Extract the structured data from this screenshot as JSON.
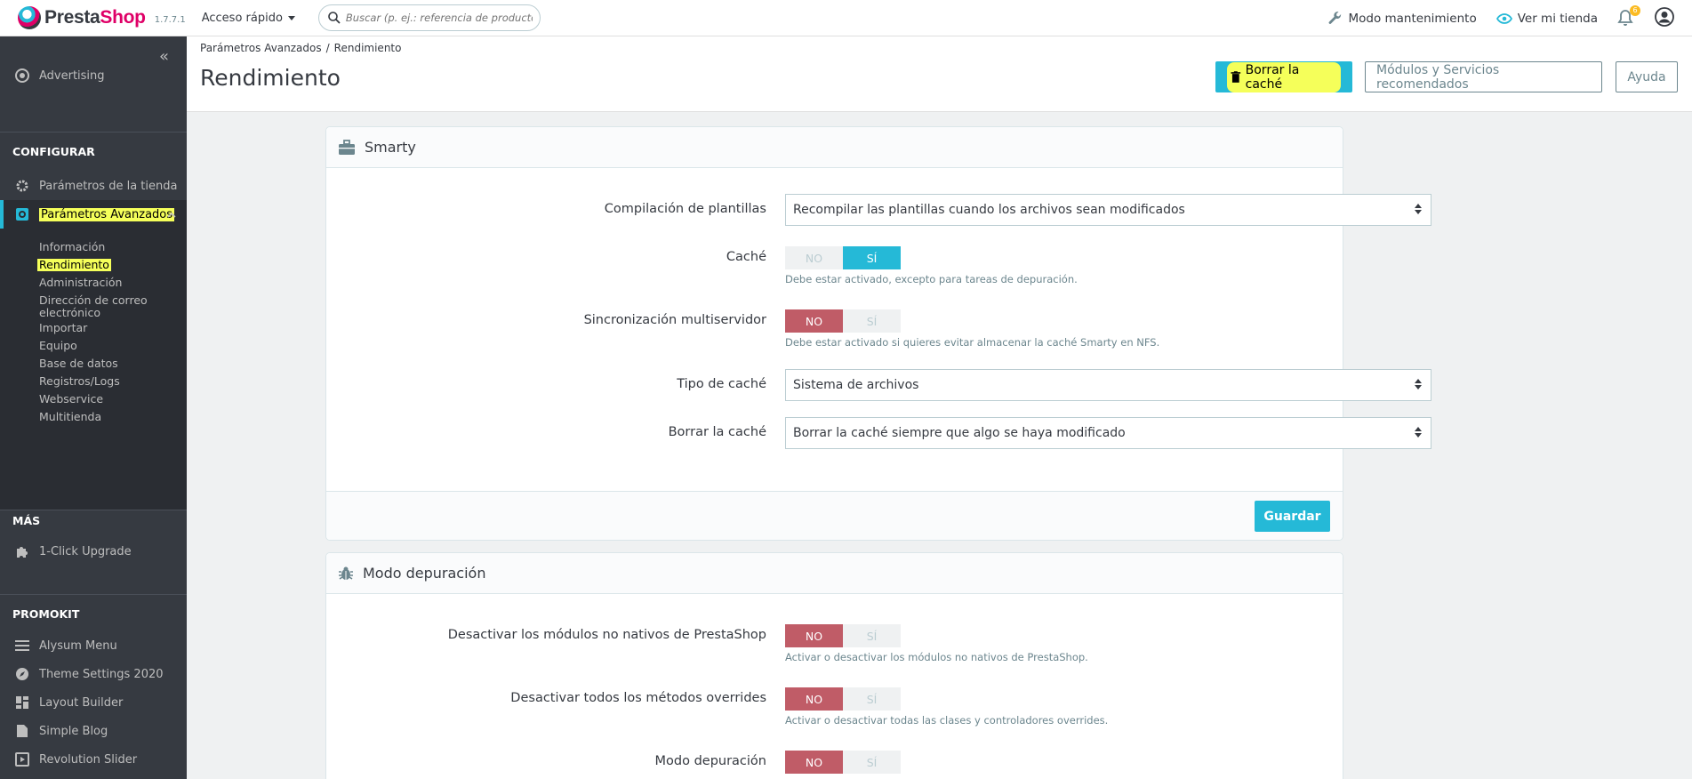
{
  "header": {
    "logo_prefix": "Presta",
    "logo_suffix": "Shop",
    "version": "1.7.7.1",
    "quick_access": "Acceso rápido",
    "search_placeholder": "Buscar (p. ej.: referencia de producto, n",
    "maintenance": "Modo mantenimiento",
    "view_store": "Ver mi tienda",
    "notifications_count": "6"
  },
  "sidebar": {
    "collapse": "«",
    "advertising": "Advertising",
    "configure_title": "CONFIGURAR",
    "store_params": "Parámetros de la tienda",
    "advanced_params": "Parámetros Avanzados",
    "submenu": [
      "Información",
      "Rendimiento",
      "Administración",
      "Dirección de correo electrónico",
      "Importar",
      "Equipo",
      "Base de datos",
      "Registros/Logs",
      "Webservice",
      "Multitienda"
    ],
    "more_title": "MÁS",
    "upgrade": "1-Click Upgrade",
    "promokit_title": "PROMOKIT",
    "promokit_items": [
      "Alysum Menu",
      "Theme Settings 2020",
      "Layout Builder",
      "Simple Blog",
      "Revolution Slider"
    ]
  },
  "page": {
    "breadcrumb_parent": "Parámetros Avanzados",
    "breadcrumb_sep": "/",
    "breadcrumb_current": "Rendimiento",
    "title": "Rendimiento",
    "btn_clear_cache": "Borrar la caché",
    "btn_modules": "Módulos y Servicios recomendados",
    "btn_help": "Ayuda"
  },
  "smarty": {
    "title": "Smarty",
    "template_compilation_label": "Compilación de plantillas",
    "template_compilation_value": "Recompilar las plantillas cuando los archivos sean modificados",
    "cache_label": "Caché",
    "cache_help": "Debe estar activado, excepto para tareas de depuración.",
    "multi_sync_label": "Sincronización multiservidor",
    "multi_sync_help": "Debe estar activado si quieres evitar almacenar la caché Smarty en NFS.",
    "cache_type_label": "Tipo de caché",
    "cache_type_value": "Sistema de archivos",
    "clear_cache_label": "Borrar la caché",
    "clear_cache_value": "Borrar la caché siempre que algo se haya modificado",
    "save": "Guardar"
  },
  "debug": {
    "title": "Modo depuración",
    "disable_non_native_label": "Desactivar los módulos no nativos de PrestaShop",
    "disable_non_native_help": "Activar o desactivar los módulos no nativos de PrestaShop.",
    "disable_overrides_label": "Desactivar todos los métodos overrides",
    "disable_overrides_help": "Activar o desactivar todas las clases y controladores overrides.",
    "debug_mode_label": "Modo depuración"
  },
  "switch_labels": {
    "no": "NO",
    "yes": "SÍ"
  },
  "colors": {
    "accent": "#25b9d7",
    "danger": "#c05c67",
    "highlight": "#f5ff5a",
    "sidebar": "#363a41"
  }
}
